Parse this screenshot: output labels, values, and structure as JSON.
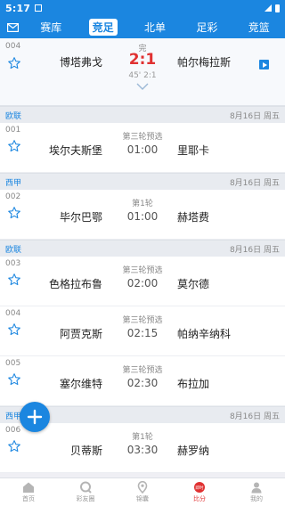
{
  "status_bar": {
    "time": "5:17"
  },
  "tabs": [
    "赛库",
    "竞足",
    "北单",
    "足彩",
    "竞篮"
  ],
  "top_match": {
    "num": "004",
    "home": "博塔弗戈",
    "away": "帕尔梅拉斯",
    "status": "完",
    "score": "2:1",
    "half_time": "45' 2:1"
  },
  "leagues": [
    {
      "name": "欧联",
      "date": "8月16日 周五"
    },
    {
      "name": "西甲",
      "date": "8月16日 周五"
    },
    {
      "name": "欧联",
      "date": "8月16日 周五"
    },
    {
      "name": "西甲",
      "date": "8月16日 周五"
    }
  ],
  "matches": [
    {
      "num": "001",
      "round": "第三轮预选",
      "time": "01:00",
      "home": "埃尔夫斯堡",
      "away": "里耶卡"
    },
    {
      "num": "002",
      "round": "第1轮",
      "time": "01:00",
      "home": "毕尔巴鄂",
      "away": "赫塔费"
    },
    {
      "num": "003",
      "round": "第三轮预选",
      "time": "02:00",
      "home": "色格拉布鲁",
      "away": "莫尔德"
    },
    {
      "num": "004",
      "round": "第三轮预选",
      "time": "02:15",
      "home": "阿贾克斯",
      "away": "帕纳辛纳科"
    },
    {
      "num": "005",
      "round": "第三轮预选",
      "time": "02:30",
      "home": "塞尔维特",
      "away": "布拉加"
    },
    {
      "num": "006",
      "round": "第1轮",
      "time": "03:30",
      "home": "贝蒂斯",
      "away": "赫罗纳"
    }
  ],
  "bottom_nav": [
    "首页",
    "彩友圈",
    "锦囊",
    "比分",
    "我的"
  ],
  "bottom_nav_badge": "即时",
  "colors": {
    "brand": "#1b86e0",
    "score": "#e03131"
  },
  "icons": [
    "mail-icon",
    "star-icon",
    "video-play-icon",
    "chevron-down-icon",
    "plus-icon",
    "home-icon",
    "chat-icon",
    "location-pin-icon",
    "scoreboard-icon",
    "user-icon"
  ]
}
